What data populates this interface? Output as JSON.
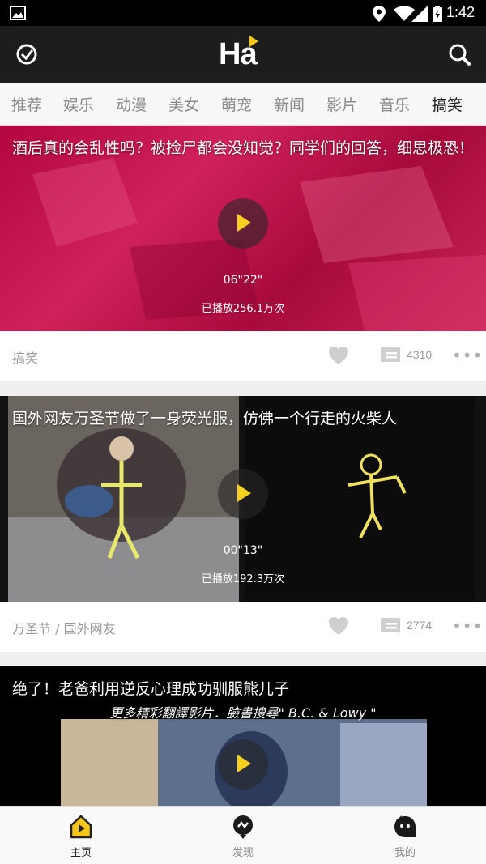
{
  "status_bar": {
    "time": "1:42"
  },
  "app": {
    "logo_text": "Ha"
  },
  "tabs": [
    {
      "label": "推荐"
    },
    {
      "label": "娱乐"
    },
    {
      "label": "动漫"
    },
    {
      "label": "美女"
    },
    {
      "label": "萌宠"
    },
    {
      "label": "新闻"
    },
    {
      "label": "影片"
    },
    {
      "label": "音乐"
    },
    {
      "label": "搞笑",
      "active": true
    }
  ],
  "feed": [
    {
      "title": "酒后真的会乱性吗？被捡尸都会没知觉？同学们的回答，细思极恐！",
      "duration": "06\"22\"",
      "plays": "已播放256.1万次",
      "tags": "搞笑",
      "comments": "4310"
    },
    {
      "title": "国外网友万圣节做了一身荧光服，仿佛一个行走的火柴人",
      "duration": "00\"13\"",
      "plays": "已播放192.3万次",
      "tags": "万圣节 / 国外网友",
      "comments": "2774"
    },
    {
      "title": "绝了！老爸利用逆反心理成功驯服熊儿子",
      "subtitle_overlay": "更多精彩翻譯影片．臉書搜尋\" B.C. & Lowy \""
    }
  ],
  "bottom_nav": [
    {
      "label": "主页",
      "active": true
    },
    {
      "label": "发现"
    },
    {
      "label": "我的"
    }
  ],
  "colors": {
    "accent": "#f5c518",
    "appbar": "#1d1d1d"
  }
}
